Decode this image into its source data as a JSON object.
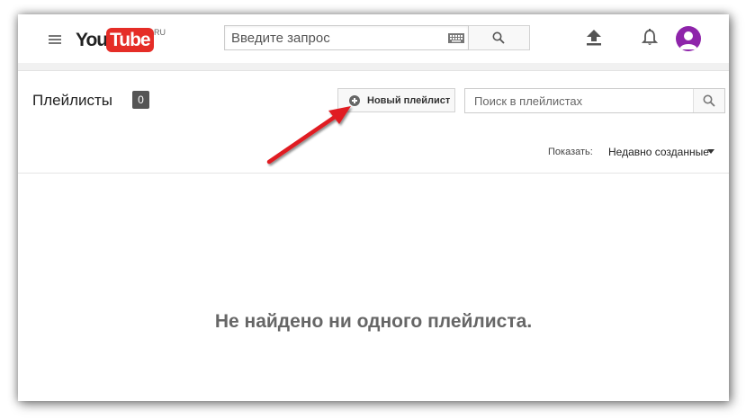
{
  "header": {
    "logo_you": "You",
    "logo_tube": "Tube",
    "logo_region": "RU",
    "search_placeholder": "Введите запрос"
  },
  "playlists": {
    "title": "Плейлисты",
    "count": "0",
    "new_playlist_label": "Новый плейлист",
    "search_placeholder": "Поиск в плейлистах",
    "sort_label": "Показать:",
    "sort_value": "Недавно созданные",
    "empty_message": "Не найдено ни одного плейлиста."
  },
  "colors": {
    "brand_red": "#e52d27",
    "avatar_purple": "#8e24aa",
    "annotation_arrow": "#e01b22"
  }
}
